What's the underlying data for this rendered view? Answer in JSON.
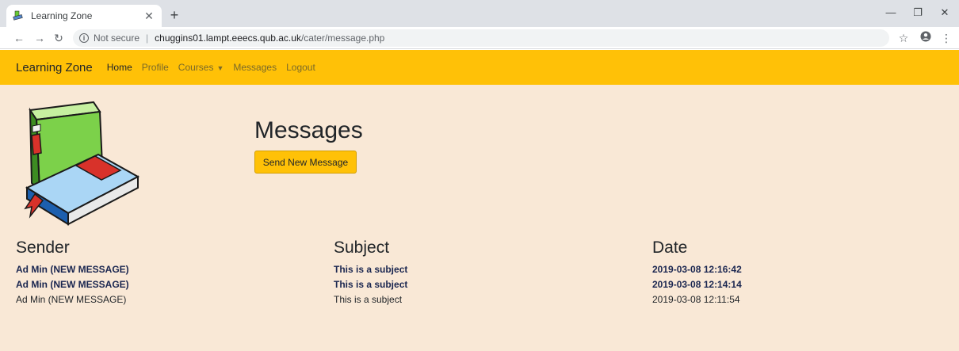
{
  "browser": {
    "tab_title": "Learning Zone",
    "url_status": "Not secure",
    "url_host": "chuggins01.lampt.eeecs.qub.ac.uk",
    "url_path": "/cater/message.php"
  },
  "navbar": {
    "brand": "Learning Zone",
    "links": {
      "home": "Home",
      "profile": "Profile",
      "courses": "Courses",
      "messages": "Messages",
      "logout": "Logout"
    }
  },
  "page": {
    "title": "Messages",
    "send_button": "Send New Message"
  },
  "table": {
    "headers": {
      "sender": "Sender",
      "subject": "Subject",
      "date": "Date"
    },
    "rows": [
      {
        "sender": "Ad Min (NEW MESSAGE)",
        "subject": "This is a subject",
        "date": "2019-03-08 12:16:42",
        "unread": true
      },
      {
        "sender": "Ad Min (NEW MESSAGE)",
        "subject": "This is a subject",
        "date": "2019-03-08 12:14:14",
        "unread": true
      },
      {
        "sender": "Ad Min (NEW MESSAGE)",
        "subject": "This is a subject",
        "date": "2019-03-08 12:11:54",
        "unread": false
      }
    ]
  },
  "colors": {
    "navbar": "#ffc107",
    "content_bg": "#f9e8d6",
    "unread_text": "#1a2650"
  },
  "icons": {
    "favicon": "book-icon",
    "logo": "books-logo-icon"
  }
}
